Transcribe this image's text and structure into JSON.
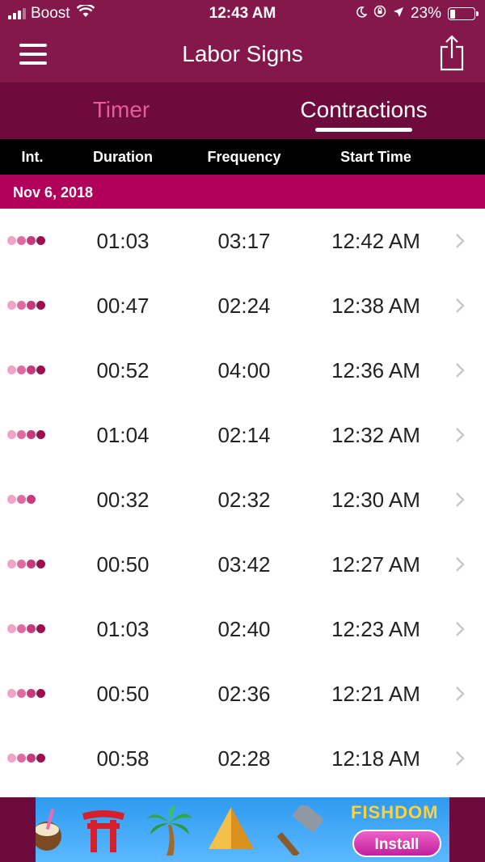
{
  "status_bar": {
    "carrier": "Boost",
    "time": "12:43 AM",
    "battery": "23%",
    "battery_level": 0.23
  },
  "nav": {
    "title": "Labor Signs",
    "menu_icon": "hamburger-menu-icon",
    "share_icon": "share-icon"
  },
  "tabs": [
    {
      "label": "Timer",
      "selected": false
    },
    {
      "label": "Contractions",
      "selected": true
    }
  ],
  "columns": {
    "intensity": "Int.",
    "duration": "Duration",
    "frequency": "Frequency",
    "start_time": "Start Time"
  },
  "section": {
    "date": "Nov 6, 2018"
  },
  "colors": {
    "header_bar": "#84184b",
    "tabs_bg": "#6c0b3c",
    "section_bar": "#b1005a",
    "tab_inactive": "#e75b9e",
    "dot_1": "#f4a3c4",
    "dot_2": "#e06aa1",
    "dot_3": "#c9377d",
    "dot_4": "#9e0d4f"
  },
  "rows": [
    {
      "intensity": 4,
      "duration": "01:03",
      "frequency": "03:17",
      "start_time": "12:42 AM"
    },
    {
      "intensity": 4,
      "duration": "00:47",
      "frequency": "02:24",
      "start_time": "12:38 AM"
    },
    {
      "intensity": 4,
      "duration": "00:52",
      "frequency": "04:00",
      "start_time": "12:36 AM"
    },
    {
      "intensity": 4,
      "duration": "01:04",
      "frequency": "02:14",
      "start_time": "12:32 AM"
    },
    {
      "intensity": 3,
      "duration": "00:32",
      "frequency": "02:32",
      "start_time": "12:30 AM"
    },
    {
      "intensity": 4,
      "duration": "00:50",
      "frequency": "03:42",
      "start_time": "12:27 AM"
    },
    {
      "intensity": 4,
      "duration": "01:03",
      "frequency": "02:40",
      "start_time": "12:23 AM"
    },
    {
      "intensity": 4,
      "duration": "00:50",
      "frequency": "02:36",
      "start_time": "12:21 AM"
    },
    {
      "intensity": 4,
      "duration": "00:58",
      "frequency": "02:28",
      "start_time": "12:18 AM"
    }
  ],
  "ad": {
    "brand": "FISHDOM",
    "install_label": "Install"
  }
}
